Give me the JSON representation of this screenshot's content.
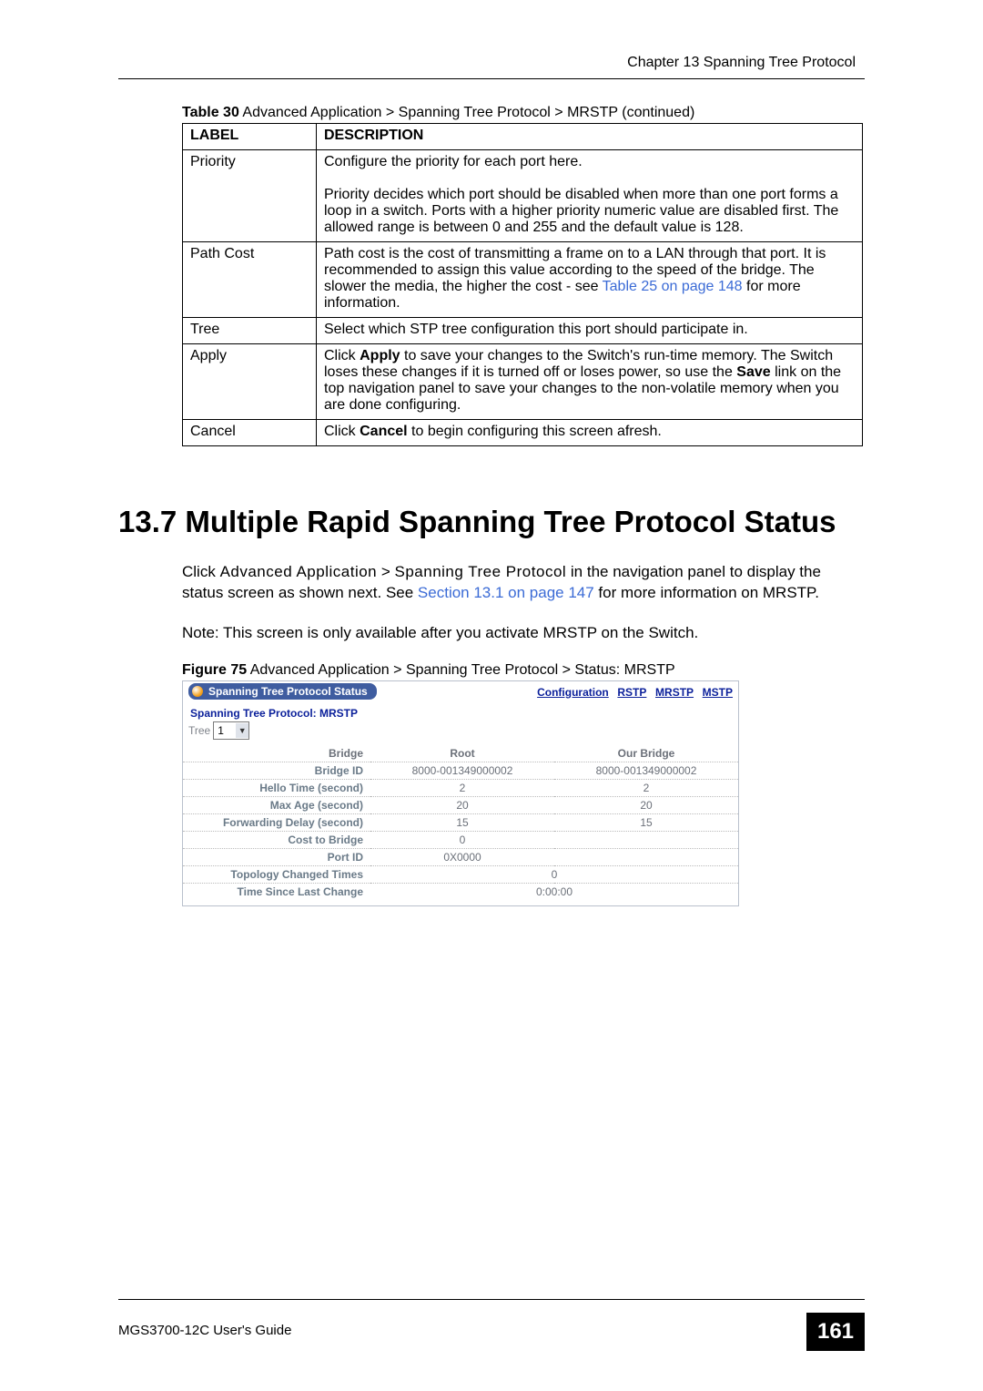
{
  "chapter_header": "Chapter 13 Spanning Tree Protocol",
  "table_caption": {
    "prefix": "Table 30",
    "text": "   Advanced Application > Spanning Tree Protocol > MRSTP  (continued)"
  },
  "table": {
    "headers": {
      "label": "LABEL",
      "description": "DESCRIPTION"
    },
    "rows": [
      {
        "label": "Priority",
        "desc_p1": "Configure the priority for each port here.",
        "desc_p2": "Priority decides which port should be disabled when more than one port forms a loop in a switch. Ports with a higher priority numeric value are disabled first. The allowed range is between 0 and 255 and the default value is 128."
      },
      {
        "label": "Path Cost",
        "desc_pre": "Path cost is the cost of transmitting a frame on to a LAN through that port. It is recommended to assign this value according to the speed of the bridge. The slower the media, the higher the cost - see ",
        "link1": "Table 25 on page 148",
        "desc_post": " for more information."
      },
      {
        "label": "Tree",
        "desc": "Select which STP tree configuration this port should participate in."
      },
      {
        "label": "Apply",
        "desc_pre": "Click ",
        "apply_word": "Apply",
        "desc_mid1": " to save your changes to the Switch's run-time memory. The Switch loses these changes if it is turned off or loses power, so use the ",
        "save_word": "Save",
        "desc_mid2": " link on the top navigation panel to save your changes to the non-volatile memory when you are done configuring."
      },
      {
        "label": "Cancel",
        "desc_pre": "Click ",
        "cancel_word": "Cancel",
        "desc_post": " to begin configuring this screen afresh."
      }
    ]
  },
  "section_title": "13.7  Multiple Rapid Spanning Tree Protocol Status",
  "paragraph": {
    "pre": "Click ",
    "nav1": "Advanced Application",
    "gt": " > ",
    "nav2": "Spanning Tree Protocol",
    "mid": " in the navigation panel to display the status screen as shown next. See ",
    "link": "Section 13.1 on page 147",
    "post": " for more information on MRSTP."
  },
  "note": "Note: This screen is only available after you activate MRSTP on the Switch.",
  "figure_caption": {
    "prefix": "Figure 75",
    "text": "   Advanced Application > Spanning Tree Protocol > Status: MRSTP"
  },
  "screenshot": {
    "tab_title": "Spanning Tree Protocol Status",
    "links": {
      "cfg": "Configuration",
      "rstp": "RSTP",
      "mrstp": "MRSTP",
      "mstp": "MSTP"
    },
    "subtitle": "Spanning Tree Protocol: MRSTP",
    "tree_label": "Tree",
    "tree_value": "1",
    "columns": {
      "bridge": "Bridge",
      "root": "Root",
      "our": "Our Bridge"
    },
    "rows": {
      "bridge_id": {
        "label": "Bridge ID",
        "root": "8000-001349000002",
        "our": "8000-001349000002"
      },
      "hello": {
        "label": "Hello Time (second)",
        "root": "2",
        "our": "2"
      },
      "maxage": {
        "label": "Max Age (second)",
        "root": "20",
        "our": "20"
      },
      "fwd": {
        "label": "Forwarding Delay (second)",
        "root": "15",
        "our": "15"
      },
      "cost": {
        "label": "Cost to Bridge",
        "root": "0",
        "our": ""
      },
      "portid": {
        "label": "Port ID",
        "root": "0X0000",
        "our": ""
      },
      "topo": {
        "label": "Topology Changed Times",
        "val": "0"
      },
      "since": {
        "label": "Time Since Last Change",
        "val": "0:00:00"
      }
    }
  },
  "footer": {
    "guide": "MGS3700-12C User's Guide",
    "page": "161"
  }
}
